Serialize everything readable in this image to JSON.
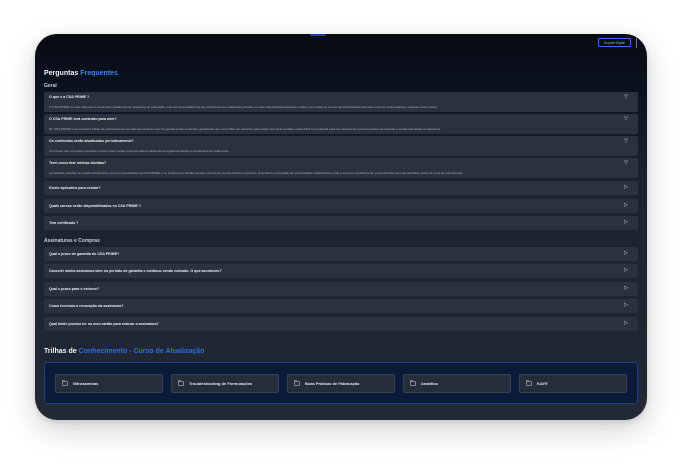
{
  "header": {
    "top_button": "Suporte Digital"
  },
  "faq": {
    "title_prefix": "Perguntas",
    "title_accent": "Frequentes",
    "sections": [
      {
        "label": "Geral",
        "items": [
          {
            "question": "O que é a CSA PRIME ?",
            "answer": "O CSA PRIME é muito mais que uma simples plataforma de streaming de educação, mas sim uma plataforma de conhecimento e networking focado no setor industrial farmacêutico e afins, com todos os cursos da CSA Educacional para você ver onde quando e quantas vezes quiser.",
            "icon": "chevron-down"
          },
          {
            "question": "O CSA PRIME terá conteúdo para mim?",
            "answer": "No CSA PRIME você encontra trilhas de conhecimento em sistema exclusivo que foi gerado pelos contextos, garantindo que você trilhe um caminho para seguir sem ficar perdido. Cada trilha foi projetada para ser atemporal e possui estudos ao assunto e tendências atuais compatíveis.",
            "icon": "chevron-down"
          },
          {
            "question": "Os conteúdos serão atualizados periodicamente?",
            "answer": "Com base nas correções previstas, novos cursos serão proporcionados utilizando as regulamentações e tendências de cada tema.",
            "icon": "chevron-down"
          },
          {
            "question": "Terei como tirar minhas dúvidas?",
            "answer": "As dúvidas poderão ser tiradas diretamente com os especialistas da CSA PRIME e os professores lotados através dos fóruns de discussões exclusivos. É também a formação de comunidades colaborativas onde a troca de conhecimento proporcionará uma oportunidade única de troca de experiências.",
            "icon": "chevron-down"
          },
          {
            "question": "Existe aplicativo para celular?",
            "answer": "",
            "icon": "chevron-right"
          },
          {
            "question": "Quais cursos serão disponibilizados no CSA PRIME ?",
            "answer": "",
            "icon": "chevron-right"
          },
          {
            "question": "Tem certificado ?",
            "answer": "",
            "icon": "chevron-right"
          }
        ]
      },
      {
        "label": "Assinaturas e Compras",
        "items": [
          {
            "question": "Qual o prazo de garantia do CSA PRIME?",
            "answer": "",
            "icon": "chevron-right"
          },
          {
            "question": "Cancelei minha assinatura bem no período de garantia e continuo sendo cobrado. O que aconteceu?",
            "answer": "",
            "icon": "chevron-right"
          },
          {
            "question": "Qual o prazo para o estorno?",
            "answer": "",
            "icon": "chevron-right"
          },
          {
            "question": "Como funciona a renovação da assinatura?",
            "answer": "",
            "icon": "chevron-right"
          },
          {
            "question": "Qual limite preciso ter no meu cartão para realizar a assinatura?",
            "answer": "",
            "icon": "chevron-right"
          }
        ]
      }
    ]
  },
  "trilhas": {
    "title_prefix": "Trilhas de",
    "title_accent": "Conhecimento - Curso de Atualização",
    "cards": [
      {
        "label": "Nitrosaminas",
        "icon": "folder"
      },
      {
        "label": "Troubleshooting de Formulações",
        "icon": "folder"
      },
      {
        "label": "Boas Práticas de Fabricação",
        "icon": "folder"
      },
      {
        "label": "Analítica",
        "icon": "folder"
      },
      {
        "label": "KAYE",
        "icon": "folder"
      }
    ]
  }
}
